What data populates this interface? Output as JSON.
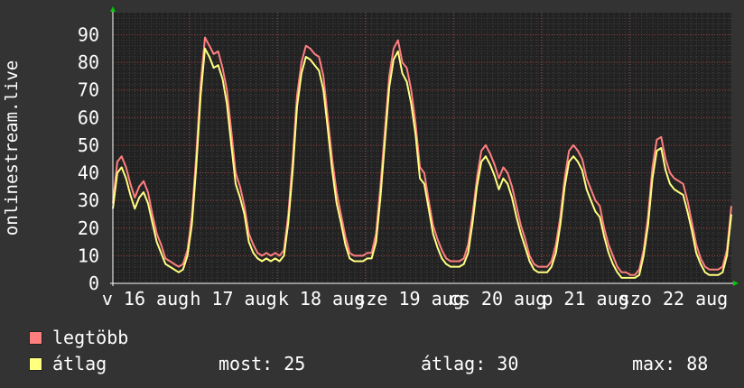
{
  "chart_data": {
    "type": "line",
    "ylabel": "onlinestream.live",
    "ylim": [
      0,
      98
    ],
    "yticks": [
      0,
      10,
      20,
      30,
      40,
      50,
      60,
      70,
      80,
      90
    ],
    "xtick_labels": [
      "v 16 aug",
      "h 17 aug",
      "k 18 aug",
      "sze 19 aug",
      "cs 20 aug",
      "p 21 aug",
      "szo 22 aug"
    ],
    "grid": true,
    "legend_placement": "bottom-left",
    "series": [
      {
        "name": "legtöbb",
        "color": "#ff7f7f",
        "hourly": [
          29,
          44,
          46,
          42,
          36,
          31,
          35,
          37,
          33,
          25,
          18,
          14,
          9,
          8,
          7,
          6,
          7,
          12,
          24,
          46,
          72,
          89,
          86,
          83,
          84,
          78,
          70,
          55,
          40,
          35,
          28,
          18,
          14,
          11,
          10,
          11,
          10,
          11,
          10,
          12,
          25,
          45,
          68,
          80,
          86,
          85,
          83,
          82,
          75,
          60,
          45,
          33,
          25,
          17,
          11,
          10,
          10,
          10,
          11,
          11,
          18,
          35,
          55,
          75,
          85,
          88,
          80,
          78,
          70,
          58,
          42,
          40,
          30,
          21,
          16,
          12,
          9,
          8,
          8,
          8,
          9,
          14,
          25,
          38,
          48,
          50,
          47,
          43,
          38,
          42,
          40,
          35,
          28,
          21,
          16,
          10,
          7,
          6,
          6,
          6,
          8,
          14,
          24,
          38,
          48,
          50,
          48,
          45,
          38,
          34,
          30,
          28,
          20,
          14,
          10,
          6,
          4,
          4,
          3,
          3,
          5,
          12,
          24,
          42,
          52,
          53,
          45,
          40,
          38,
          37,
          36,
          30,
          22,
          14,
          9,
          6,
          5,
          5,
          5,
          6,
          12,
          28
        ]
      },
      {
        "name": "átlag",
        "color": "#ffff80",
        "hourly": [
          27,
          40,
          42,
          38,
          32,
          27,
          31,
          33,
          29,
          22,
          15,
          11,
          7,
          6,
          5,
          4,
          5,
          10,
          21,
          42,
          68,
          85,
          82,
          78,
          79,
          74,
          65,
          50,
          36,
          31,
          25,
          15,
          11,
          9,
          8,
          9,
          8,
          9,
          8,
          10,
          22,
          41,
          64,
          76,
          82,
          81,
          79,
          77,
          70,
          56,
          41,
          29,
          22,
          14,
          9,
          8,
          8,
          8,
          9,
          9,
          15,
          31,
          51,
          71,
          81,
          84,
          76,
          73,
          65,
          54,
          38,
          36,
          27,
          18,
          13,
          9,
          7,
          6,
          6,
          6,
          7,
          11,
          22,
          35,
          44,
          46,
          43,
          39,
          34,
          38,
          36,
          31,
          24,
          18,
          13,
          8,
          5,
          4,
          4,
          4,
          6,
          11,
          21,
          35,
          44,
          46,
          44,
          41,
          34,
          30,
          26,
          24,
          17,
          11,
          7,
          4,
          2,
          2,
          2,
          2,
          3,
          10,
          21,
          38,
          48,
          49,
          41,
          36,
          34,
          33,
          32,
          26,
          19,
          11,
          7,
          4,
          3,
          3,
          3,
          4,
          10,
          25
        ]
      }
    ],
    "stats": {
      "current": {
        "label": "most:",
        "value": 25
      },
      "average": {
        "label": "átlag:",
        "value": 30
      },
      "max": {
        "label": "max:",
        "value": 88
      }
    }
  }
}
